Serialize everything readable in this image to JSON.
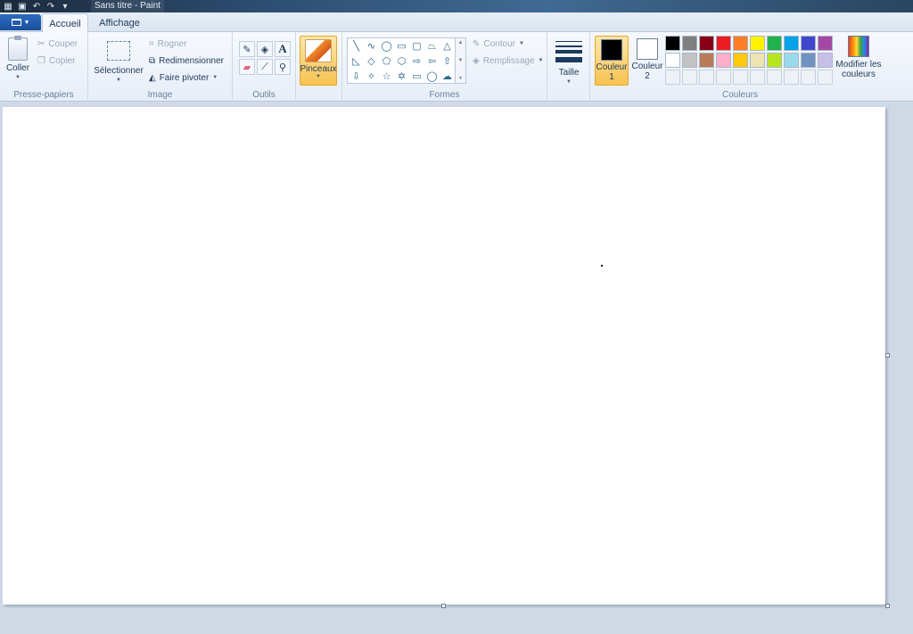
{
  "window": {
    "title": "Sans titre - Paint"
  },
  "tabs": [
    {
      "label": "Accueil",
      "active": true
    },
    {
      "label": "Affichage",
      "active": false
    }
  ],
  "ribbon": {
    "clipboard": {
      "label": "Presse-papiers",
      "paste": "Coller",
      "cut": "Couper",
      "copy": "Copier"
    },
    "image": {
      "label": "Image",
      "select": "Sélectionner",
      "crop": "Rogner",
      "resize": "Redimensionner",
      "rotate": "Faire pivoter"
    },
    "tools": {
      "label": "Outils",
      "text_glyph": "A"
    },
    "brushes": {
      "label": "Pinceaux"
    },
    "shapes": {
      "label": "Formes",
      "outline": "Contour",
      "fill": "Remplissage"
    },
    "size": {
      "label": "Taille"
    },
    "colors": {
      "label": "Couleurs",
      "color1_line1": "Couleur",
      "color1_line2": "1",
      "color2_line1": "Couleur",
      "color2_line2": "2",
      "color1_value": "#000000",
      "color2_value": "#ffffff",
      "edit_line1": "Modifier les",
      "edit_line2": "couleurs",
      "palette": [
        "#000000",
        "#7f7f7f",
        "#880015",
        "#ed1c24",
        "#ff7f27",
        "#fff200",
        "#22b14c",
        "#00a2e8",
        "#3f48cc",
        "#a349a4",
        "#ffffff",
        "#c3c3c3",
        "#b97a57",
        "#ffaec9",
        "#ffc90e",
        "#efe4b0",
        "#b5e61d",
        "#99d9ea",
        "#7092be",
        "#c8bfe7"
      ]
    }
  }
}
